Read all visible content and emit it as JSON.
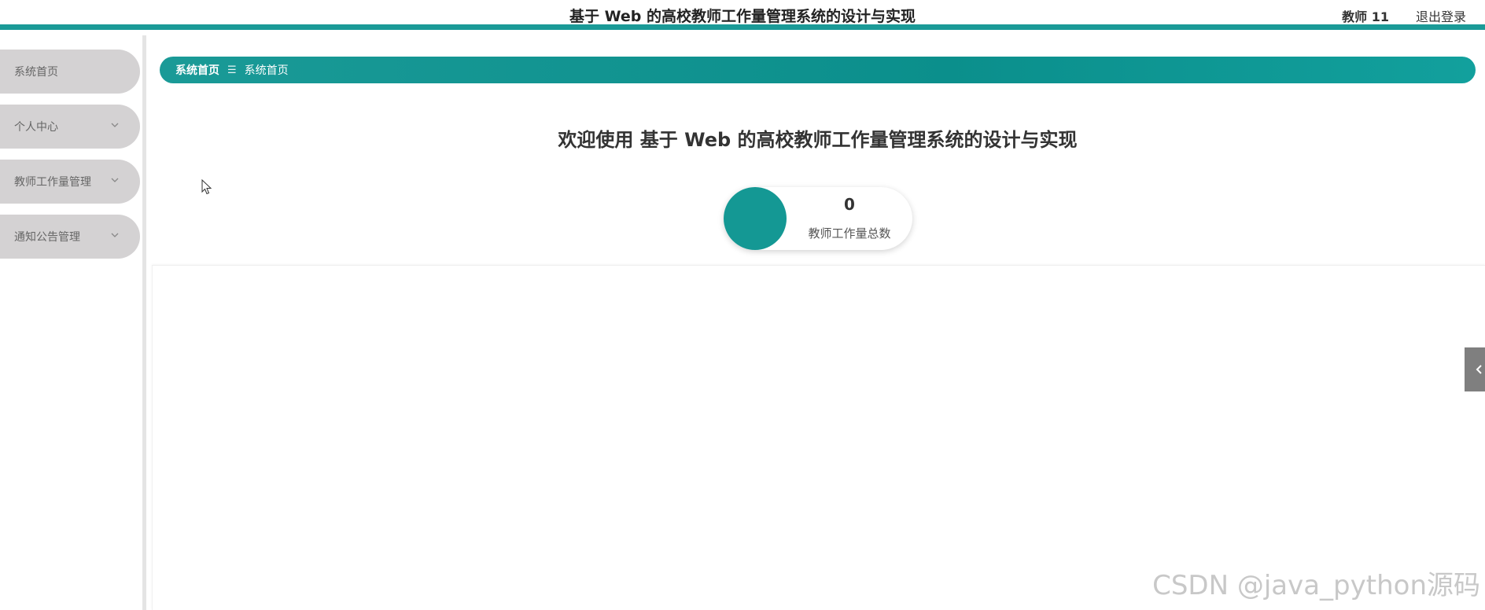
{
  "header": {
    "title": "基于 Web 的高校教师工作量管理系统的设计与实现",
    "user": "教师 11",
    "logout": "退出登录"
  },
  "sidebar": {
    "items": [
      {
        "label": "系统首页",
        "has_submenu": false
      },
      {
        "label": "个人中心",
        "has_submenu": true
      },
      {
        "label": "教师工作量管理",
        "has_submenu": true
      },
      {
        "label": "通知公告管理",
        "has_submenu": true
      }
    ]
  },
  "breadcrumb": {
    "first": "系统首页",
    "separator": "☰",
    "current": "系统首页"
  },
  "main": {
    "welcome": "欢迎使用 基于 Web 的高校教师工作量管理系统的设计与实现",
    "stat": {
      "value": "0",
      "label": "教师工作量总数"
    }
  },
  "watermark": "CSDN @java_python源码",
  "colors": {
    "accent": "#1a9a97",
    "sidebar_item": "#d4d2d3",
    "toggle": "#7f7f7f"
  },
  "icons": {
    "submenu": "chevron-down-icon",
    "toggle": "chevron-left-icon",
    "cursor": "mouse-pointer-icon"
  }
}
